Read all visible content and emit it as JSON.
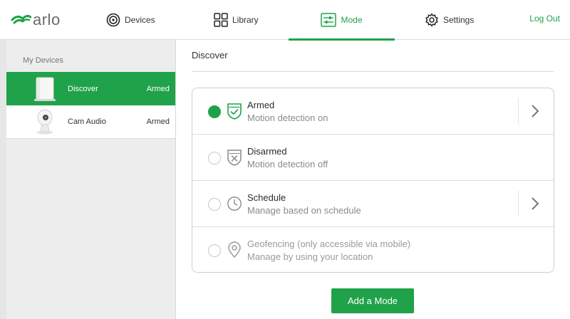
{
  "colors": {
    "accent": "#1fa24a",
    "sidebar_bg": "#ededed",
    "text": "#333333",
    "muted": "#8a8a8a"
  },
  "logo": {
    "text": "arlo",
    "icon": "arlo-wave-icon"
  },
  "nav": {
    "devices": {
      "label": "Devices",
      "icon": "devices-icon"
    },
    "library": {
      "label": "Library",
      "icon": "library-grid-icon"
    },
    "mode": {
      "label": "Mode",
      "icon": "mode-sliders-icon",
      "active": true
    },
    "settings": {
      "label": "Settings",
      "icon": "gear-icon"
    },
    "logout": "Log Out"
  },
  "sidebar": {
    "heading": "My Devices",
    "devices": [
      {
        "name": "Discover",
        "status": "Armed",
        "active": true,
        "thumb": "base-station-thumbnail"
      },
      {
        "name": "Cam Audio",
        "status": "Armed",
        "active": false,
        "thumb": "camera-thumbnail"
      }
    ]
  },
  "main": {
    "title": "Discover",
    "modes": [
      {
        "name": "Armed",
        "description": "Motion detection on",
        "selected": true,
        "icon": "shield-check-icon",
        "has_chevron": true,
        "disabled": false
      },
      {
        "name": "Disarmed",
        "description": "Motion detection off",
        "selected": false,
        "icon": "shield-x-icon",
        "has_chevron": false,
        "disabled": false
      },
      {
        "name": "Schedule",
        "description": "Manage based on schedule",
        "selected": false,
        "icon": "clock-icon",
        "has_chevron": true,
        "disabled": false
      },
      {
        "name": "Geofencing (only accessible via mobile)",
        "description": "Manage by using your location",
        "selected": false,
        "icon": "location-pin-icon",
        "has_chevron": false,
        "disabled": true
      }
    ],
    "add_button": "Add a Mode"
  }
}
